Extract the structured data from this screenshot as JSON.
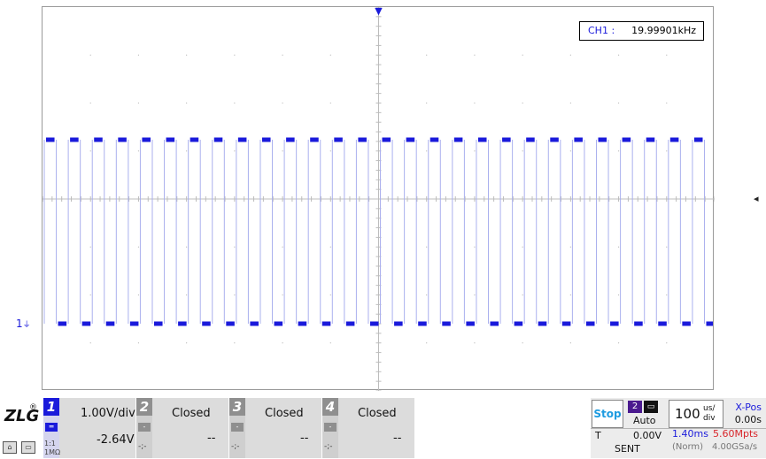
{
  "plot": {
    "measurement": {
      "label": "CH1 :",
      "value": "19.99901kHz"
    },
    "channel_marker": "1",
    "grid_divisions": {
      "x": 14,
      "y": 8
    },
    "waveform": {
      "channel": "CH1",
      "shape": "square",
      "frequency_khz": 19.99901,
      "time_per_div_us": 100,
      "volts_per_div": 1.0,
      "offset_v": -2.64,
      "cycles_visible": 28,
      "color": "#1a1adb"
    },
    "right_arrow": "◂",
    "trigger_marker": "▼"
  },
  "logo": {
    "text": "ZLG",
    "mark": "®"
  },
  "channels": [
    {
      "num": "1",
      "scale": "1.00V/div",
      "offset": "-2.64V",
      "coupling": "DC",
      "probe": "1:1",
      "impedance": "1MΩ"
    },
    {
      "num": "2",
      "state": "Closed",
      "offset": "--",
      "coupling": "-",
      "small": "-;-"
    },
    {
      "num": "3",
      "state": "Closed",
      "offset": "--",
      "coupling": "-",
      "small": "-;-"
    },
    {
      "num": "4",
      "state": "Closed",
      "offset": "--",
      "coupling": "-",
      "small": "-;-"
    }
  ],
  "status": {
    "run_state": "Stop",
    "trigger_source": "2",
    "trigger_mode": "Auto",
    "timebase_value": "100",
    "timebase_unit_top": "us/",
    "timebase_unit_bottom": "div",
    "xpos_label": "X-Pos",
    "xpos_value": "0.00s",
    "trigger_label": "T",
    "trigger_level": "0.00V",
    "trigger_position": "1.40ms",
    "memory_depth": "5.60Mpts",
    "acq_state": "SENT",
    "acq_mode": "(Norm)",
    "sample_rate": "4.00GSa/s"
  },
  "colors": {
    "ch1": "#1a1adb",
    "stop": "#1e9be0",
    "memory": "#d8262b"
  }
}
